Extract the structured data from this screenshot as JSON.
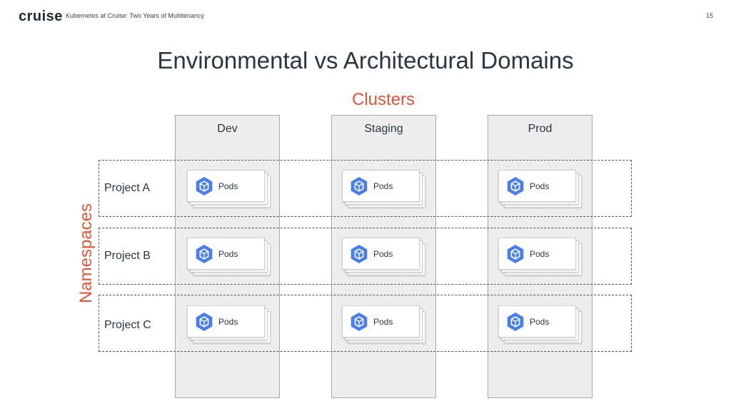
{
  "header": {
    "logo": "cruise",
    "subtitle": "Kubernetes at Cruise: Two Years of Multitenancy",
    "page_number": "15"
  },
  "slide": {
    "title": "Environmental vs Architectural Domains",
    "clusters_label": "Clusters",
    "namespaces_label": "Namespaces"
  },
  "clusters": [
    "Dev",
    "Staging",
    "Prod"
  ],
  "projects": [
    "Project A",
    "Project B",
    "Project C"
  ],
  "pods": [
    [
      "Pods",
      "Pods",
      "Pods"
    ],
    [
      "Pods",
      "Pods",
      "Pods"
    ],
    [
      "Pods",
      "Pods",
      "Pods"
    ]
  ],
  "colors": {
    "accent": "#e5533c",
    "pod_icon": "#4a7ee8",
    "cluster_bg": "#ededed",
    "text": "#2a3640"
  },
  "icons": {
    "pod": "kubernetes-pod-hexagon-icon"
  }
}
